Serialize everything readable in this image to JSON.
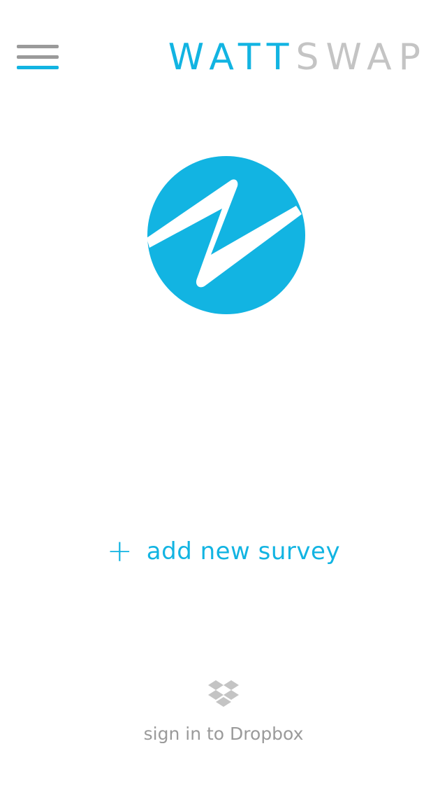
{
  "colors": {
    "accent": "#12b4e2",
    "gray": "#9a9a9a",
    "light_gray": "#c4c4c4",
    "background": "#ffffff"
  },
  "header": {
    "menu_icon": "hamburger-menu-icon",
    "logo_part1": "WATT",
    "logo_part2": "SWAP"
  },
  "main": {
    "brand_icon": "wattswap-circle-logo",
    "add_survey_icon": "plus-icon",
    "add_survey_label": "add new survey"
  },
  "footer": {
    "dropbox_icon": "dropbox-icon",
    "dropbox_label": "sign in to Dropbox"
  }
}
